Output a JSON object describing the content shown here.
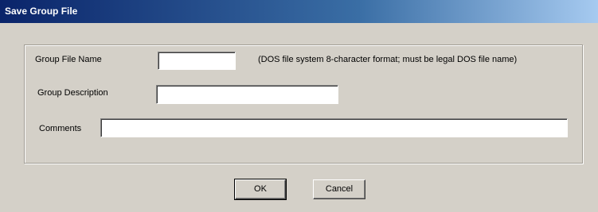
{
  "window": {
    "title": "Save Group File"
  },
  "form": {
    "group_file_name": {
      "label": "Group File Name",
      "value": "",
      "hint": "(DOS file system 8-character format; must be legal DOS file name)"
    },
    "group_description": {
      "label": "Group Description",
      "value": ""
    },
    "comments": {
      "label": "Comments",
      "value": ""
    }
  },
  "buttons": {
    "ok": "OK",
    "cancel": "Cancel"
  }
}
